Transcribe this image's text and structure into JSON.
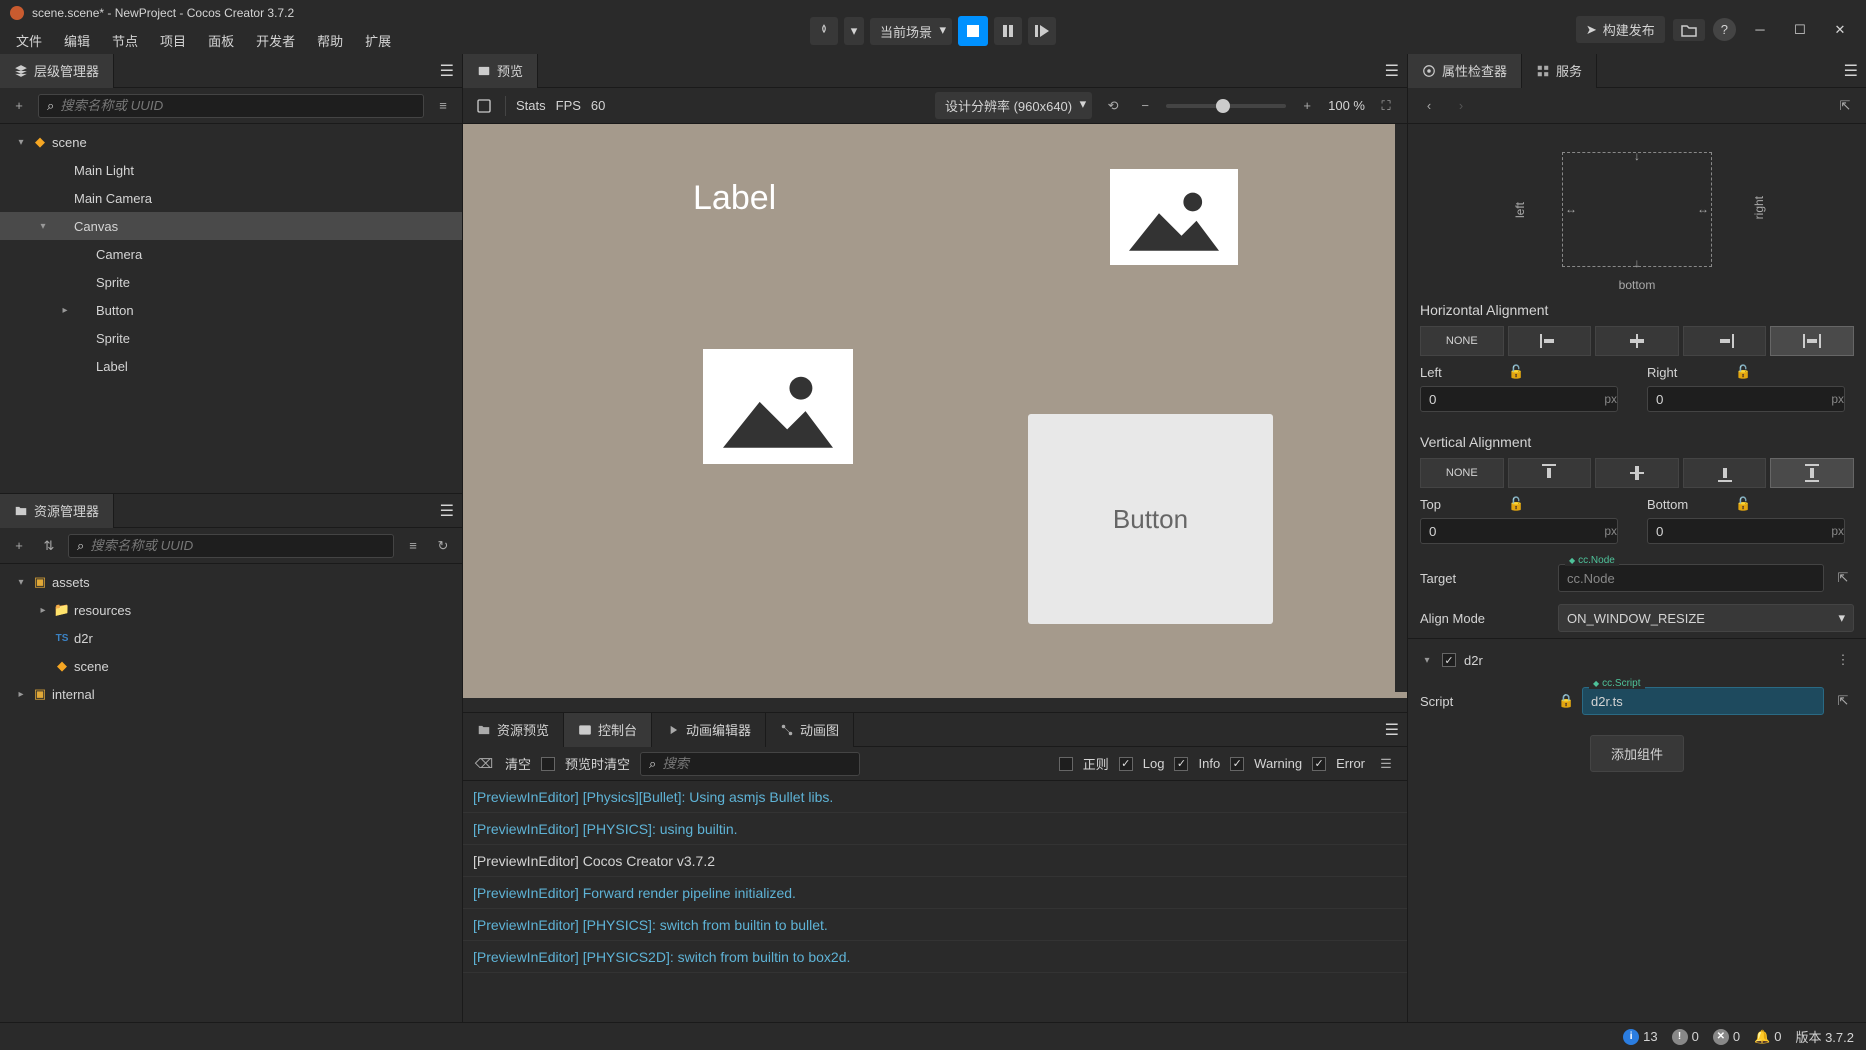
{
  "title": "scene.scene* - NewProject - Cocos Creator 3.7.2",
  "menu": [
    "文件",
    "编辑",
    "节点",
    "项目",
    "面板",
    "开发者",
    "帮助",
    "扩展"
  ],
  "topToolbar": {
    "sceneMode": "当前场景"
  },
  "topRight": {
    "build": "构建发布"
  },
  "hierarchy": {
    "title": "层级管理器",
    "searchPlaceholder": "搜索名称或 UUID",
    "tree": [
      {
        "label": "scene",
        "indent": 0,
        "chev": "▾",
        "ico": "fire"
      },
      {
        "label": "Main Light",
        "indent": 1
      },
      {
        "label": "Main Camera",
        "indent": 1
      },
      {
        "label": "Canvas",
        "indent": 1,
        "chev": "▾",
        "selected": true
      },
      {
        "label": "Camera",
        "indent": 2
      },
      {
        "label": "Sprite",
        "indent": 2
      },
      {
        "label": "Button",
        "indent": 2,
        "chev": "▸"
      },
      {
        "label": "Sprite",
        "indent": 2
      },
      {
        "label": "Label",
        "indent": 2
      }
    ]
  },
  "assets": {
    "title": "资源管理器",
    "searchPlaceholder": "搜索名称或 UUID",
    "tree": [
      {
        "label": "assets",
        "indent": 0,
        "chev": "▾",
        "ico": "assets"
      },
      {
        "label": "resources",
        "indent": 1,
        "chev": "▸",
        "ico": "folder"
      },
      {
        "label": "d2r",
        "indent": 1,
        "ico": "ts"
      },
      {
        "label": "scene",
        "indent": 1,
        "ico": "fire"
      },
      {
        "label": "internal",
        "indent": 0,
        "chev": "▸",
        "ico": "assets"
      }
    ]
  },
  "scene": {
    "tab": "预览",
    "stats": "Stats",
    "fps": "FPS",
    "fpsVal": "60",
    "resolution": "设计分辨率 (960x640)",
    "zoom": "100 %",
    "labelText": "Label",
    "buttonText": "Button"
  },
  "bottom": {
    "tabs": [
      "资源预览",
      "控制台",
      "动画编辑器",
      "动画图"
    ],
    "activeTab": 1,
    "clear": "清空",
    "clearOnPlay": "预览时清空",
    "searchPlaceholder": "搜索",
    "regex": "正则",
    "filters": [
      "Log",
      "Info",
      "Warning",
      "Error"
    ],
    "logs": [
      {
        "type": "info",
        "text": "[PreviewInEditor] [Physics][Bullet]: Using asmjs Bullet libs."
      },
      {
        "type": "info",
        "text": "[PreviewInEditor] [PHYSICS]: using builtin."
      },
      {
        "type": "plain",
        "text": "[PreviewInEditor] Cocos Creator v3.7.2"
      },
      {
        "type": "info",
        "text": "[PreviewInEditor] Forward render pipeline initialized."
      },
      {
        "type": "info",
        "text": "[PreviewInEditor] [PHYSICS]: switch from builtin to bullet."
      },
      {
        "type": "info",
        "text": "[PreviewInEditor] [PHYSICS2D]: switch from builtin to box2d."
      }
    ]
  },
  "inspector": {
    "tabs": [
      "属性检查器",
      "服务"
    ],
    "anchorBottom": "bottom",
    "anchorLeft": "left",
    "anchorRight": "right",
    "hAlign": "Horizontal Alignment",
    "vAlign": "Vertical Alignment",
    "none": "NONE",
    "left": "Left",
    "right": "Right",
    "top": "Top",
    "bottomLbl": "Bottom",
    "leftVal": "0",
    "rightVal": "0",
    "topVal": "0",
    "bottomVal": "0",
    "unit": "px",
    "target": "Target",
    "targetType": "cc.Node",
    "targetVal": "cc.Node",
    "alignMode": "Align Mode",
    "alignModeVal": "ON_WINDOW_RESIZE",
    "compName": "d2r",
    "script": "Script",
    "scriptType": "cc.Script",
    "scriptVal": "d2r.ts",
    "addComp": "添加组件"
  },
  "status": {
    "info": "13",
    "warn": "0",
    "error": "0",
    "notif": "0",
    "version": "版本 3.7.2"
  }
}
